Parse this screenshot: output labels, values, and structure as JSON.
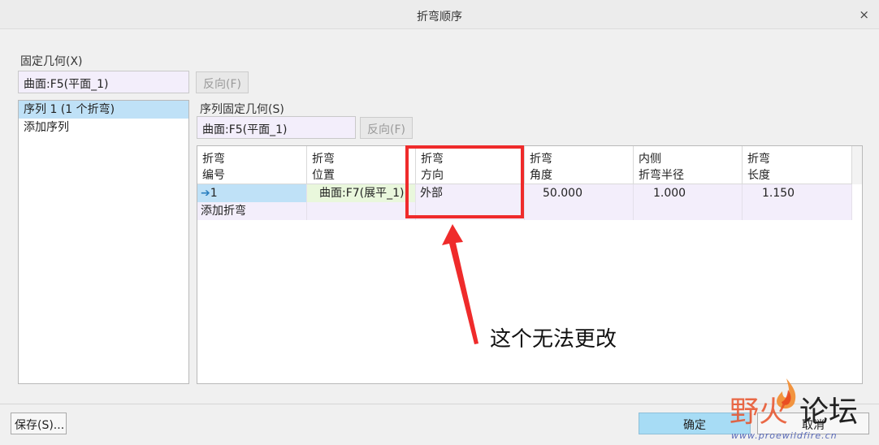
{
  "window": {
    "title": "折弯顺序",
    "close_glyph": "×"
  },
  "fixed_geometry": {
    "label": "固定几何(X)",
    "value": "曲面:F5(平面_1)",
    "flip_button": "反向(F)"
  },
  "sequences": [
    {
      "label": "序列 1 (1 个折弯)",
      "selected": true
    },
    {
      "label": "添加序列",
      "selected": false
    }
  ],
  "sequence_fixed_geometry": {
    "label": "序列固定几何(S)",
    "value": "曲面:F5(平面_1)",
    "flip_button": "反向(F)"
  },
  "table": {
    "columns": [
      {
        "line1": "折弯",
        "line2": "编号"
      },
      {
        "line1": "折弯",
        "line2": "位置"
      },
      {
        "line1": "折弯",
        "line2": "方向"
      },
      {
        "line1": "折弯",
        "line2": "角度"
      },
      {
        "line1": "内侧",
        "line2": "折弯半径"
      },
      {
        "line1": "折弯",
        "line2": "长度"
      }
    ],
    "rows": [
      {
        "number": "1",
        "arrow": "➔",
        "location": "曲面:F7(展平_1)",
        "direction": "外部",
        "angle": "50.000",
        "radius": "1.000",
        "length": "1.150"
      }
    ],
    "add_row_label": "添加折弯"
  },
  "annotation": {
    "text": "这个无法更改",
    "color": "#ef2b2b"
  },
  "footer": {
    "save_button": "保存(S)...",
    "ok_button": "确定",
    "cancel_button": "取消"
  },
  "watermark": {
    "part1": "野火",
    "part2": "论坛",
    "url": "www.proewildfire.cn"
  }
}
